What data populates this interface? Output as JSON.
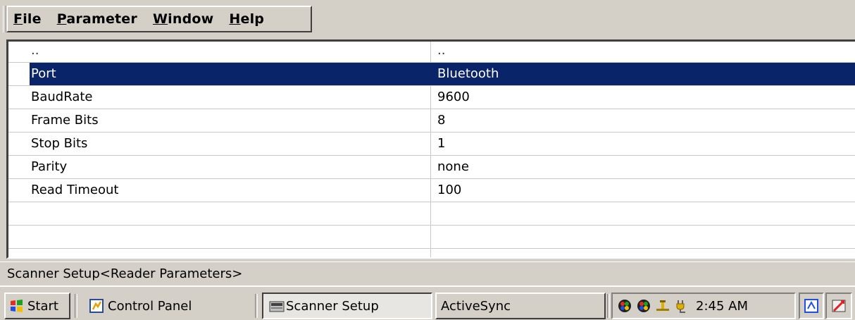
{
  "menu": [
    {
      "accel": "F",
      "rest": "ile"
    },
    {
      "accel": "P",
      "rest": "arameter"
    },
    {
      "accel": "W",
      "rest": "indow"
    },
    {
      "accel": "H",
      "rest": "elp"
    }
  ],
  "list": {
    "header_row": {
      "name": "..",
      "value": ".."
    },
    "rows": [
      {
        "name": "Port",
        "value": "Bluetooth",
        "selected": true
      },
      {
        "name": "BaudRate",
        "value": "9600"
      },
      {
        "name": "Frame Bits",
        "value": "8"
      },
      {
        "name": "Stop Bits",
        "value": "1"
      },
      {
        "name": "Parity",
        "value": "none"
      },
      {
        "name": "Read Timeout",
        "value": "100"
      },
      {
        "name": "",
        "value": ""
      },
      {
        "name": "",
        "value": ""
      },
      {
        "name": "",
        "value": ""
      }
    ]
  },
  "status": {
    "text": "Scanner Setup<Reader Parameters>"
  },
  "taskbar": {
    "start_label": "Start",
    "buttons": [
      {
        "label": "Control Panel",
        "icon": "control-panel-icon"
      },
      {
        "label": "Scanner Setup",
        "icon": "scanner-setup-icon",
        "active": true
      },
      {
        "label": "ActiveSync"
      }
    ],
    "tray": {
      "icons": [
        "network-icon",
        "network-icon-2",
        "usb-connection-icon",
        "power-plug-icon"
      ],
      "time": "2:45 AM"
    },
    "extra_icons": [
      "keyboard-input-icon",
      "desktop-icon"
    ]
  },
  "colors": {
    "selection": "#0a246a",
    "chrome": "#d4d0c8"
  }
}
